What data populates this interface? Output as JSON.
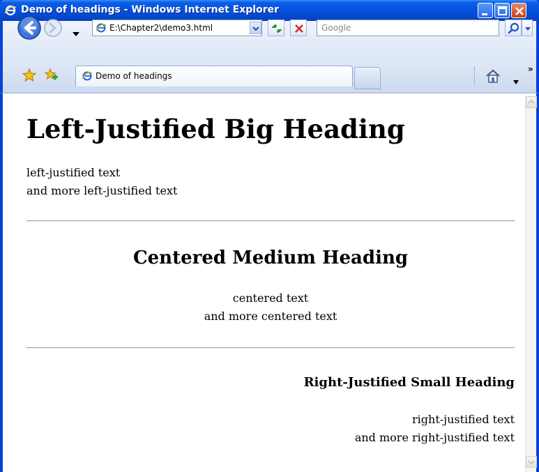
{
  "window": {
    "title": "Demo of headings - Windows Internet Explorer"
  },
  "navigation": {
    "address": "E:\\Chapter2\\demo3.html",
    "search_placeholder": "Google"
  },
  "tabs": [
    {
      "label": "Demo of headings",
      "active": true
    }
  ],
  "toolbar": {
    "more_chevron": "»"
  },
  "page": {
    "big_heading": "Left-Justified Big Heading",
    "left_text": [
      "left-justified text",
      "and more left-justified text"
    ],
    "medium_heading": "Centered Medium Heading",
    "center_text": [
      "centered text",
      "and more centered text"
    ],
    "small_heading": "Right-Justified Small Heading",
    "right_text": [
      "right-justified text",
      "and more right-justified text"
    ]
  },
  "colors": {
    "titlebar_blue": "#0553de",
    "frame_blue": "#0842d6",
    "toolbar_bg": "#dfe8f6"
  }
}
